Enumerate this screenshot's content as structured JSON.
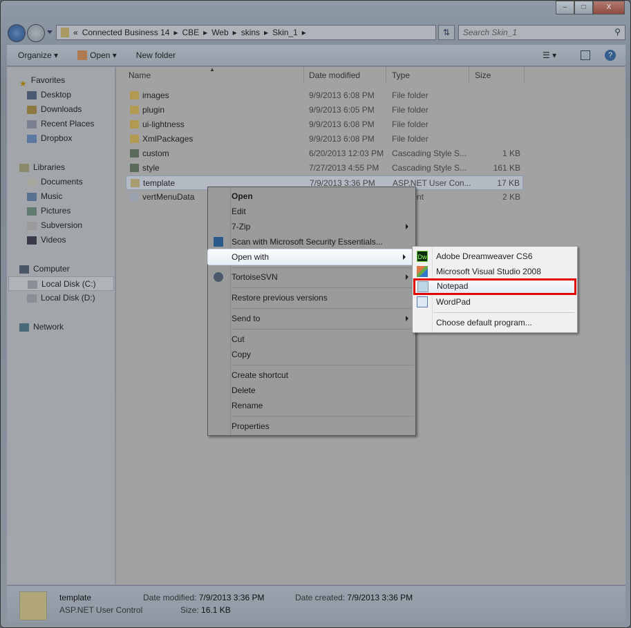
{
  "window": {
    "controls": [
      "minimize",
      "maximize",
      "close"
    ]
  },
  "address": {
    "crumbs": [
      "Connected Business 14",
      "CBE",
      "Web",
      "skins",
      "Skin_1"
    ],
    "overflow": "«"
  },
  "search": {
    "placeholder": "Search Skin_1"
  },
  "toolbar": {
    "organize": "Organize",
    "open": "Open",
    "new_folder": "New folder"
  },
  "sidebar": {
    "favorites": "Favorites",
    "fav_items": [
      "Desktop",
      "Downloads",
      "Recent Places",
      "Dropbox"
    ],
    "libraries": "Libraries",
    "lib_items": [
      "Documents",
      "Music",
      "Pictures",
      "Subversion",
      "Videos"
    ],
    "computer": "Computer",
    "comp_items": [
      "Local Disk (C:)",
      "Local Disk (D:)"
    ],
    "network": "Network"
  },
  "columns": [
    "Name",
    "Date modified",
    "Type",
    "Size"
  ],
  "files": [
    {
      "name": "images",
      "date": "9/9/2013 6:08 PM",
      "type": "File folder",
      "size": "",
      "kind": "folder"
    },
    {
      "name": "plugin",
      "date": "9/9/2013 6:05 PM",
      "type": "File folder",
      "size": "",
      "kind": "folder"
    },
    {
      "name": "ui-lightness",
      "date": "9/9/2013 6:08 PM",
      "type": "File folder",
      "size": "",
      "kind": "folder"
    },
    {
      "name": "XmlPackages",
      "date": "9/9/2013 6:08 PM",
      "type": "File folder",
      "size": "",
      "kind": "folder"
    },
    {
      "name": "custom",
      "date": "6/20/2013 12:03 PM",
      "type": "Cascading Style S...",
      "size": "1 KB",
      "kind": "css"
    },
    {
      "name": "style",
      "date": "7/27/2013 4:55 PM",
      "type": "Cascading Style S...",
      "size": "161 KB",
      "kind": "css"
    },
    {
      "name": "template",
      "date": "7/9/2013 3:36 PM",
      "type": "ASP.NET User Con...",
      "size": "17 KB",
      "kind": "ascx"
    },
    {
      "name": "vertMenuData",
      "date": "",
      "type": "ocument",
      "size": "2 KB",
      "kind": "xml"
    }
  ],
  "context_menu": [
    "Open",
    "Edit",
    "7-Zip",
    "Scan with Microsoft Security Essentials...",
    "Open with",
    "TortoiseSVN",
    "Restore previous versions",
    "Send to",
    "Cut",
    "Copy",
    "Create shortcut",
    "Delete",
    "Rename",
    "Properties"
  ],
  "submenu": [
    "Adobe Dreamweaver CS6",
    "Microsoft Visual Studio 2008",
    "Notepad",
    "WordPad",
    "Choose default program..."
  ],
  "dw_glyph": "Dw",
  "status": {
    "name": "template",
    "type": "ASP.NET User Control",
    "modified_label": "Date modified:",
    "modified": "7/9/2013 3:36 PM",
    "created_label": "Date created:",
    "created": "7/9/2013 3:36 PM",
    "size_label": "Size:",
    "size": "16.1 KB"
  },
  "highlight_color": "#e00000"
}
